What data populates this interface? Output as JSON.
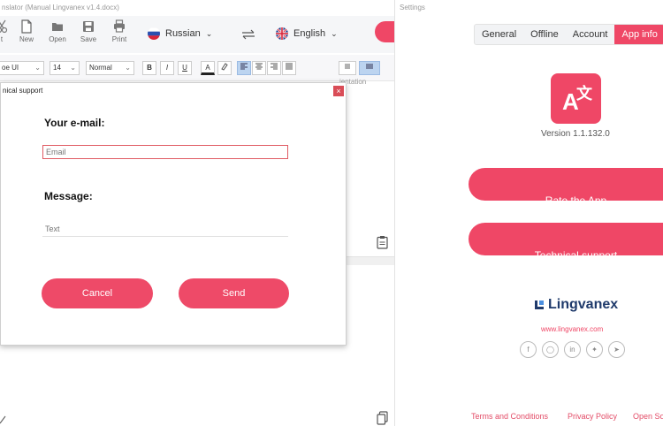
{
  "translator": {
    "title": "nslator (Manual Lingvanex v1.4.docx)",
    "toolbar": {
      "cut_label": "t",
      "new_label": "New",
      "open_label": "Open",
      "save_label": "Save",
      "print_label": "Print"
    },
    "source_language": "Russian",
    "target_language": "English",
    "format": {
      "font": "oe UI",
      "size": "14",
      "style": "Normal",
      "bold_label": "B",
      "italic_label": "I",
      "underline_label": "U",
      "font_color_label": "A",
      "orientation_label": "ientation"
    }
  },
  "dialog": {
    "title": "nical support",
    "close_label": "×",
    "email_label": "Your e-mail:",
    "email_placeholder": "Email",
    "message_label": "Message:",
    "message_placeholder": "Text",
    "cancel_label": "Cancel",
    "send_label": "Send"
  },
  "settings": {
    "window_title": "Settings",
    "tabs": [
      {
        "label": "General"
      },
      {
        "label": "Offline"
      },
      {
        "label": "Account"
      },
      {
        "label": "App info"
      }
    ],
    "version": "Version 1.1.132.0",
    "rate_label": "Rate the App",
    "support_label": "Technical support",
    "brand_name": "Lingvanex",
    "brand_url": "www.lingvanex.com",
    "footer": {
      "terms": "Terms and Conditions",
      "privacy": "Privacy Policy",
      "open_source": "Open So"
    }
  },
  "colors": {
    "accent": "#ef4766",
    "brand_dark": "#1f3a6b"
  }
}
